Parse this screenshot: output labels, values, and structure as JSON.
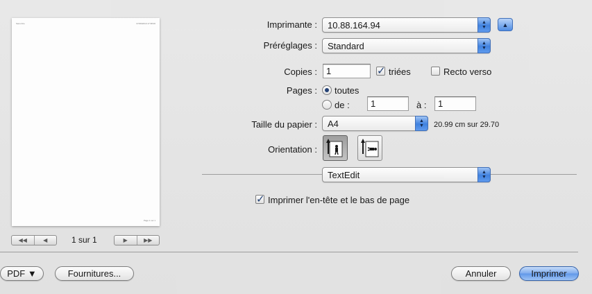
{
  "preview": {
    "header_left": "Sans titre",
    "header_right": "07/09/2010 17:38:00",
    "footer_right": "Page 1 sur 1",
    "page_indicator": "1 sur 1",
    "first_icon": "double-left-arrow-icon",
    "prev_icon": "left-arrow-icon",
    "next_icon": "right-arrow-icon",
    "last_icon": "double-right-arrow-icon"
  },
  "printer": {
    "label": "Imprimante :",
    "value": "10.88.164.94"
  },
  "presets": {
    "label": "Préréglages :",
    "value": "Standard"
  },
  "copies": {
    "label": "Copies :",
    "value": "1",
    "collated_label": "triées",
    "collated": true,
    "duplex_label": "Recto verso",
    "duplex": false
  },
  "pages": {
    "label": "Pages :",
    "all_label": "toutes",
    "from_label": "de :",
    "from_value": "1",
    "to_label": "à :",
    "to_value": "1",
    "selected": "all"
  },
  "paper": {
    "label": "Taille du papier :",
    "value": "A4",
    "size_text": "20.99 cm sur 29.70"
  },
  "orientation": {
    "label": "Orientation :",
    "selected": "portrait"
  },
  "app_menu": {
    "value": "TextEdit"
  },
  "header_footer": {
    "label": "Imprimer l'en-tête et le bas de page",
    "checked": true
  },
  "footer": {
    "pdf_label": "PDF ▼",
    "supplies_label": "Fournitures...",
    "cancel_label": "Annuler",
    "print_label": "Imprimer"
  },
  "colors": {
    "accent": "#5b95ea",
    "default_button_border": "#2f5ea8"
  }
}
